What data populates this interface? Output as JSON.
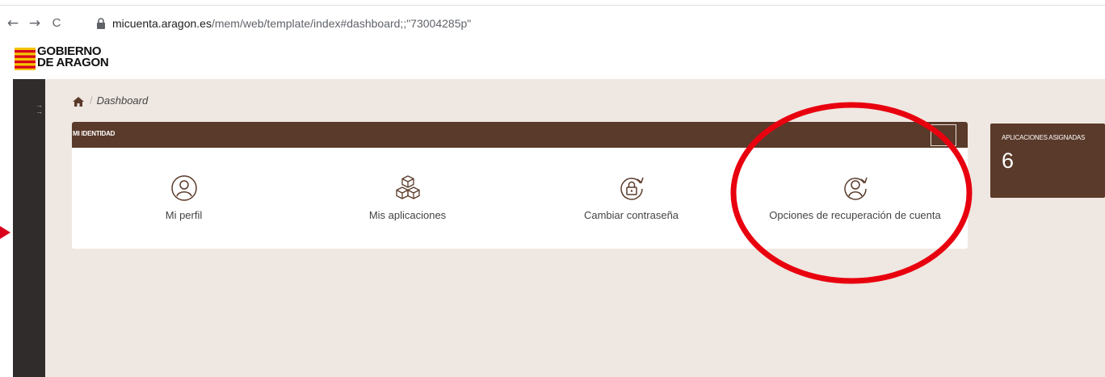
{
  "browser": {
    "back_glyph": "←",
    "forward_glyph": "→",
    "reload_glyph": "C",
    "url_host": "micuenta.aragon.es",
    "url_path": "/mem/web/template/index#dashboard;;\"73004285p\""
  },
  "header": {
    "logo_line1": "GOBIERNO",
    "logo_line2": "DE ARAGON"
  },
  "breadcrumb": {
    "separator": "/",
    "current": "Dashboard"
  },
  "card": {
    "title": "MI IDENTIDAD",
    "header_button_glyph": "›",
    "tiles": [
      {
        "label": "Mi perfil",
        "icon": "user-circle-icon"
      },
      {
        "label": "Mis aplicaciones",
        "icon": "cubes-icon"
      },
      {
        "label": "Cambiar contraseña",
        "icon": "lock-refresh-icon"
      },
      {
        "label": "Opciones de recuperación de cuenta",
        "icon": "user-refresh-icon"
      }
    ]
  },
  "apps_widget": {
    "title": "APLICACIONES ASIGNADAS",
    "count": "6"
  },
  "colors": {
    "brown": "#5a3a2a",
    "background": "#efe7e1",
    "sidebar": "#2f2c2b",
    "annotation_red": "#e8000f"
  }
}
